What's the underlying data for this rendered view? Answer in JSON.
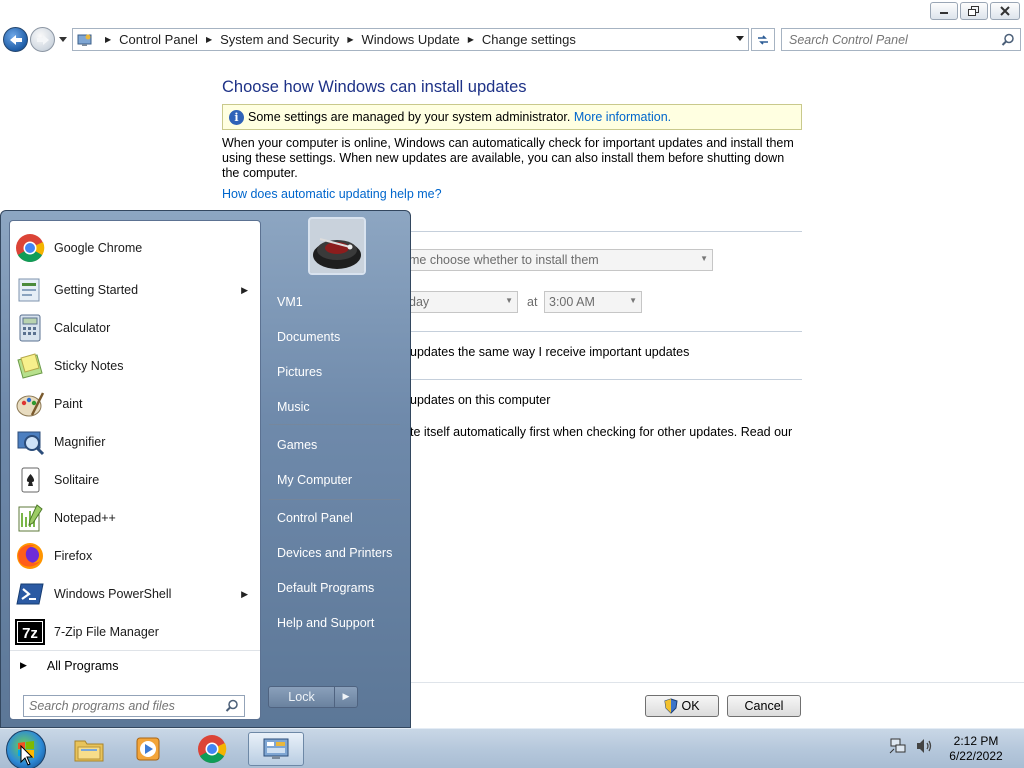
{
  "window": {
    "buttons": [
      "minimize",
      "maximize",
      "close"
    ]
  },
  "address": {
    "breadcrumbs": [
      "Control Panel",
      "System and Security",
      "Windows Update",
      "Change settings"
    ],
    "search_placeholder": "Search Control Panel"
  },
  "content": {
    "heading": "Choose how Windows can install updates",
    "admin_notice": "Some settings are managed by your system administrator.",
    "admin_link": "More information.",
    "description": "When your computer is online, Windows can automatically check for important updates and install them using these settings. When new updates are available, you can also install them before shutting down the computer.",
    "help_link": "How does automatic updating help me?",
    "important_updates_value": "me choose whether to install them",
    "day_value": "day",
    "at_label": "at",
    "time_value": "3:00 AM",
    "recommended_text": "updates the same way I receive important updates",
    "who_can_install_text": "updates on this computer",
    "microsoft_update_text": "te itself automatically first when checking for other updates.  Read our",
    "ok_label": "OK",
    "cancel_label": "Cancel"
  },
  "start_menu": {
    "programs": [
      {
        "label": "Google Chrome",
        "icon": "chrome-icon",
        "submenu": false
      },
      {
        "label": "Getting Started",
        "icon": "getting-started-icon",
        "submenu": true
      },
      {
        "label": "Calculator",
        "icon": "calculator-icon",
        "submenu": false
      },
      {
        "label": "Sticky Notes",
        "icon": "sticky-notes-icon",
        "submenu": false
      },
      {
        "label": "Paint",
        "icon": "paint-icon",
        "submenu": false
      },
      {
        "label": "Magnifier",
        "icon": "magnifier-icon",
        "submenu": false
      },
      {
        "label": "Solitaire",
        "icon": "solitaire-icon",
        "submenu": false
      },
      {
        "label": "Notepad++",
        "icon": "notepadpp-icon",
        "submenu": false
      },
      {
        "label": "Firefox",
        "icon": "firefox-icon",
        "submenu": false
      },
      {
        "label": "Windows PowerShell",
        "icon": "powershell-icon",
        "submenu": true
      },
      {
        "label": "7-Zip File Manager",
        "icon": "7zip-icon",
        "submenu": false
      }
    ],
    "all_programs": "All Programs",
    "search_placeholder": "Search programs and files",
    "right_items": [
      "VM1",
      "Documents",
      "Pictures",
      "Music",
      "Games",
      "My Computer",
      "Control Panel",
      "Devices and Printers",
      "Default Programs",
      "Help and Support"
    ],
    "lock_label": "Lock"
  },
  "taskbar": {
    "pinned": [
      "explorer-icon",
      "media-player-icon",
      "chrome-icon",
      "control-panel-icon"
    ],
    "time": "2:12 PM",
    "date": "6/22/2022"
  }
}
